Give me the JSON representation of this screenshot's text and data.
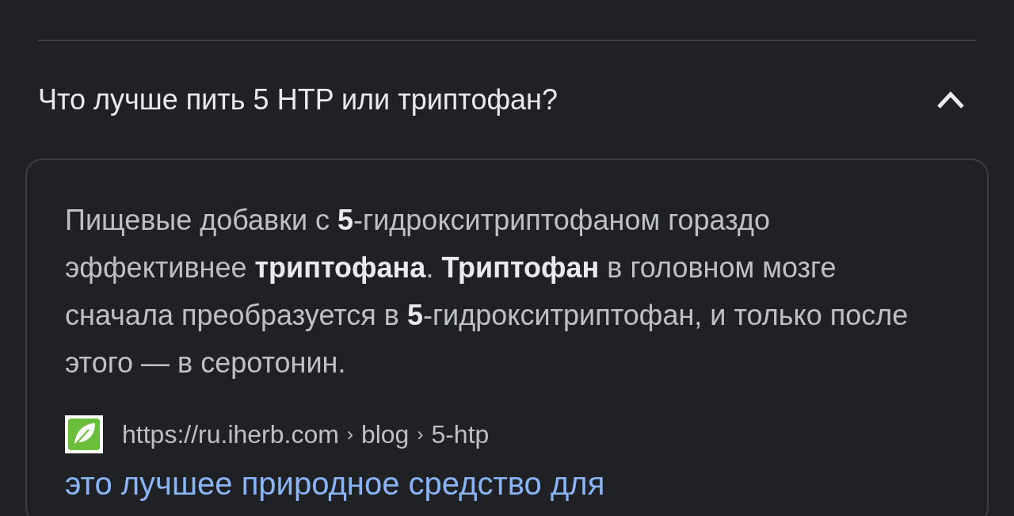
{
  "question": {
    "text": "Что лучше пить 5 HTP или триптофан?",
    "expanded": true
  },
  "answer": {
    "text": "Пищевые добавки с **5**-гидрокситриптофаном гораздо эффективнее **триптофана**. **Триптофан** в головном мозге сначала преобразуется в **5**-гидрокситриптофан, и только после этого — в серотонин."
  },
  "source": {
    "url": "https://ru.iherb.com",
    "path": [
      "blog",
      "5-htp"
    ],
    "separator": "›"
  },
  "result_title": "это лучшее природное средство для"
}
